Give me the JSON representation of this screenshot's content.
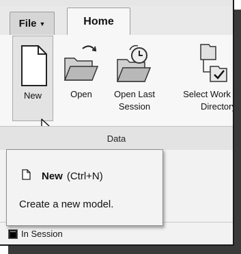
{
  "tabs": {
    "file_label": "File",
    "home_label": "Home"
  },
  "ribbon": {
    "buttons": [
      {
        "label": "New",
        "icon": "new-document-icon"
      },
      {
        "label": "Open",
        "icon": "open-folder-icon"
      },
      {
        "label_line1": "Open Last",
        "label_line2": "Session",
        "icon": "open-last-session-icon"
      },
      {
        "label_line1": "Select Work",
        "label_line2": "Directory",
        "icon": "select-working-directory-icon"
      }
    ],
    "group_label": "Data"
  },
  "tooltip": {
    "title": "New",
    "shortcut": "(Ctrl+N)",
    "description": "Create a new model.",
    "icon": "new-document-icon"
  },
  "status": {
    "label": "In Session",
    "icon": "session-window-icon"
  },
  "colors": {
    "ribbon_bg": "#f7f7f7",
    "group_label_bg": "#e3e3e3",
    "tooltip_bg": "#f3f3f3"
  }
}
